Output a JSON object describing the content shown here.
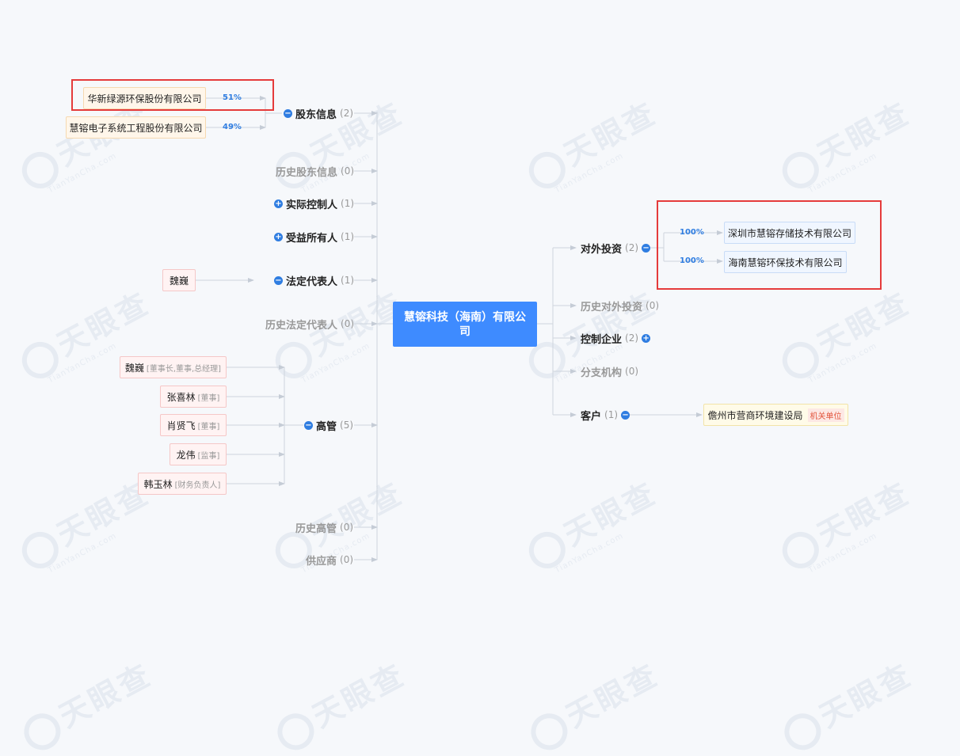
{
  "company": {
    "name": "慧镕科技（海南）有限公司"
  },
  "watermark": {
    "text": "天眼查",
    "sub": "TianYanCha.com"
  },
  "left": {
    "shareholders": {
      "label": "股东信息",
      "count": "(2)",
      "toggle": "−"
    },
    "history_shareholders": {
      "label": "历史股东信息",
      "count": "(0)"
    },
    "actual_controller": {
      "label": "实际控制人",
      "count": "(1)",
      "toggle": "+"
    },
    "beneficiary": {
      "label": "受益所有人",
      "count": "(1)",
      "toggle": "+"
    },
    "legal_rep": {
      "label": "法定代表人",
      "count": "(1)",
      "toggle": "−"
    },
    "history_legal_rep": {
      "label": "历史法定代表人",
      "count": "(0)"
    },
    "executives": {
      "label": "高管",
      "count": "(5)",
      "toggle": "−"
    },
    "history_executives": {
      "label": "历史高管",
      "count": "(0)"
    },
    "suppliers": {
      "label": "供应商",
      "count": "(0)"
    }
  },
  "shareholder_nodes": [
    {
      "name": "华新绿源环保股份有限公司",
      "pct": "51%"
    },
    {
      "name": "慧镕电子系统工程股份有限公司",
      "pct": "49%"
    }
  ],
  "legal_rep_node": {
    "name": "魏巍"
  },
  "executive_nodes": [
    {
      "name": "魏巍",
      "role": "[董事长,董事,总经理]"
    },
    {
      "name": "张喜林",
      "role": "[董事]"
    },
    {
      "name": "肖贤飞",
      "role": "[董事]"
    },
    {
      "name": "龙伟",
      "role": "[监事]"
    },
    {
      "name": "韩玉林",
      "role": "[财务负责人]"
    }
  ],
  "right": {
    "investments": {
      "label": "对外投资",
      "count": "(2)",
      "toggle": "−"
    },
    "history_investments": {
      "label": "历史对外投资",
      "count": "(0)"
    },
    "controlled": {
      "label": "控制企业",
      "count": "(2)",
      "toggle": "+"
    },
    "branches": {
      "label": "分支机构",
      "count": "(0)"
    },
    "customers": {
      "label": "客户",
      "count": "(1)",
      "toggle": "−"
    }
  },
  "investment_nodes": [
    {
      "name": "深圳市慧镕存储技术有限公司",
      "pct": "100%"
    },
    {
      "name": "海南慧镕环保技术有限公司",
      "pct": "100%"
    }
  ],
  "customer_node": {
    "name": "儋州市营商环境建设局",
    "tag": "机关单位"
  },
  "colors": {
    "accent": "#3e8bff",
    "highlight": "#e53b3b",
    "line": "#cfd5dd"
  }
}
